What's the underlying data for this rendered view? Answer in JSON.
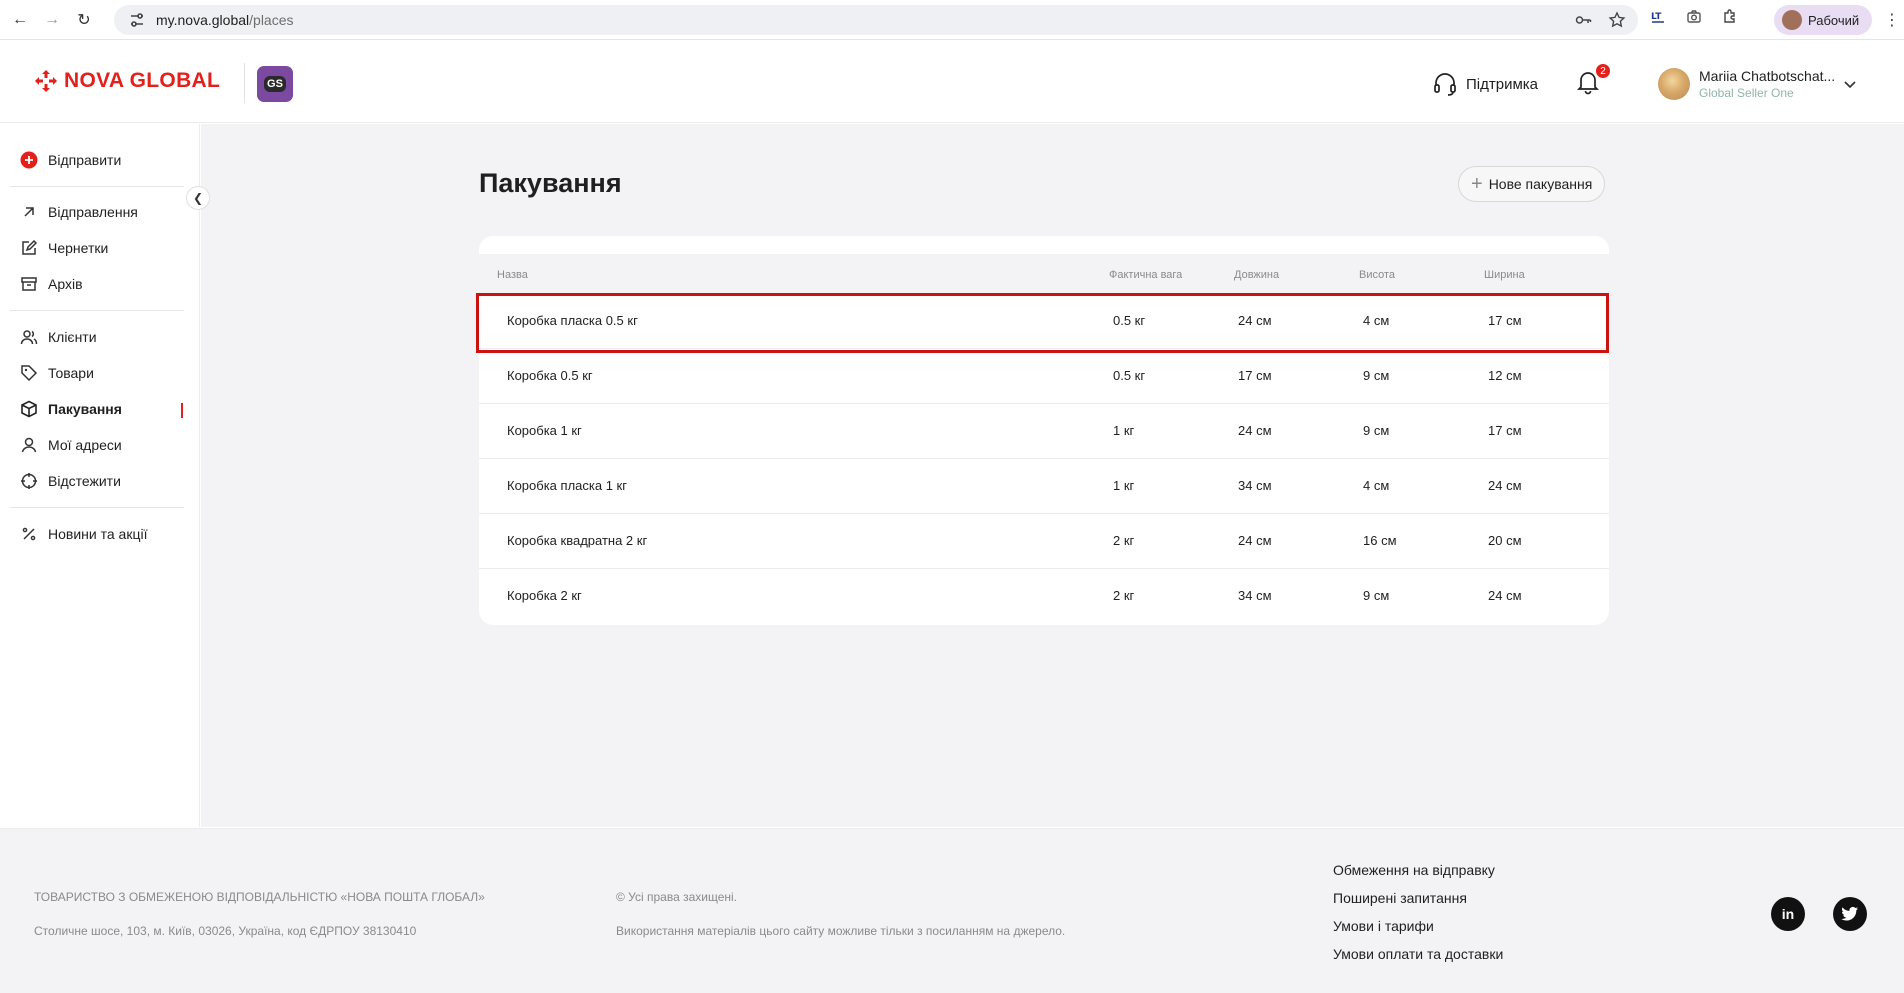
{
  "browser": {
    "url_host": "my.nova.global",
    "url_path": "/places",
    "profile_label": "Рабочий"
  },
  "header": {
    "brand": "NOVA GLOBAL",
    "badge": "GS",
    "support_label": "Підтримка",
    "notifications_count": "2",
    "user_name": "Mariia Chatbotschat...",
    "user_company": "Global Seller One"
  },
  "sidebar": {
    "send_label": "Відправити",
    "items": [
      {
        "label": "Відправлення",
        "icon": "arrow-up-right-icon"
      },
      {
        "label": "Чернетки",
        "icon": "edit-icon"
      },
      {
        "label": "Архів",
        "icon": "archive-icon"
      },
      {
        "label": "Клієнти",
        "icon": "users-icon"
      },
      {
        "label": "Товари",
        "icon": "tag-icon"
      },
      {
        "label": "Пакування",
        "icon": "box-icon",
        "active": true
      },
      {
        "label": "Мої адреси",
        "icon": "location-icon"
      },
      {
        "label": "Відстежити",
        "icon": "crosshair-icon"
      },
      {
        "label": "Новини та акції",
        "icon": "percent-icon"
      }
    ]
  },
  "main": {
    "title": "Пакування",
    "new_button": "Нове пакування",
    "columns": [
      "Назва",
      "Фактична вага",
      "Довжина",
      "Висота",
      "Ширина"
    ],
    "rows": [
      {
        "name": "Коробка пласка 0.5 кг",
        "weight": "0.5 кг",
        "length": "24 см",
        "height": "4 см",
        "width": "17 см"
      },
      {
        "name": "Коробка 0.5 кг",
        "weight": "0.5 кг",
        "length": "17 см",
        "height": "9 см",
        "width": "12 см"
      },
      {
        "name": "Коробка 1 кг",
        "weight": "1 кг",
        "length": "24 см",
        "height": "9 см",
        "width": "17 см"
      },
      {
        "name": "Коробка пласка 1 кг",
        "weight": "1 кг",
        "length": "34 см",
        "height": "4 см",
        "width": "24 см"
      },
      {
        "name": "Коробка квадратна 2 кг",
        "weight": "2 кг",
        "length": "24 см",
        "height": "16 см",
        "width": "20 см"
      },
      {
        "name": "Коробка 2 кг",
        "weight": "2 кг",
        "length": "34 см",
        "height": "9 см",
        "width": "24 см"
      }
    ]
  },
  "footer": {
    "company": "ТОВАРИСТВО З ОБМЕЖЕНОЮ ВІДПОВІДАЛЬНІСТЮ «НОВА ПОШТА ГЛОБАЛ»",
    "address": "Столичне шосе, 103, м. Київ, 03026, Україна, код ЄДРПОУ 38130410",
    "rights": "© Усі права захищені.",
    "usage": "Використання матеріалів цього сайту можливе тільки з посиланням на джерело.",
    "links": [
      "Обмеження на відправку",
      "Поширені запитання",
      "Умови і тарифи",
      "Умови оплати та доставки"
    ],
    "linkedin": "in"
  },
  "colors": {
    "brand_red": "#e2211c",
    "highlight": "#cc1111",
    "gs_purple": "#7b4aa0"
  }
}
